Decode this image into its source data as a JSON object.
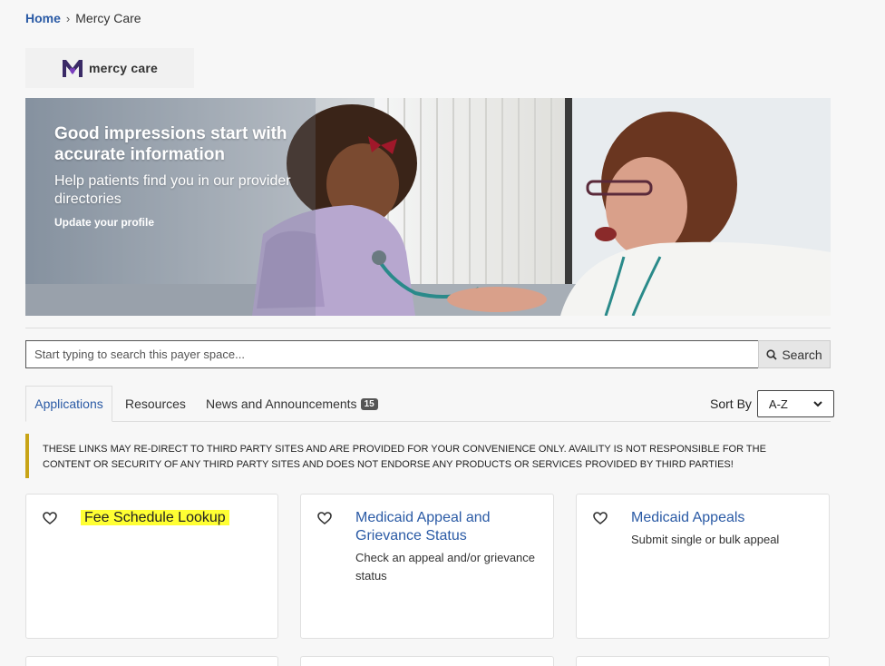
{
  "breadcrumb": {
    "home": "Home",
    "separator": "›",
    "current": "Mercy Care"
  },
  "logo": {
    "text": "mercy care",
    "accent": "#3a2a66",
    "heart": "#7b3fbf"
  },
  "hero": {
    "title": "Good impressions start with accurate information",
    "subtitle": "Help patients find you in our provider directories",
    "link": "Update your profile"
  },
  "search": {
    "placeholder": "Start typing to search this payer space...",
    "button": "Search",
    "icon": "search-icon"
  },
  "tabs": [
    {
      "label": "Applications",
      "active": true
    },
    {
      "label": "Resources",
      "active": false
    },
    {
      "label": "News and Announcements",
      "badge": "15",
      "active": false
    }
  ],
  "sort": {
    "label": "Sort By",
    "value": "A-Z"
  },
  "notice": "THESE LINKS MAY RE-DIRECT TO THIRD PARTY SITES AND ARE PROVIDED FOR YOUR CONVENIENCE ONLY. AVAILITY IS NOT RESPONSIBLE FOR THE CONTENT OR SECURITY OF ANY THIRD PARTY SITES AND DOES NOT ENDORSE ANY PRODUCTS OR SERVICES PROVIDED BY THIRD PARTIES!",
  "cards": [
    {
      "title": "Fee Schedule Lookup",
      "description": "",
      "highlighted": true
    },
    {
      "title": "Medicaid Appeal and Grievance Status",
      "description": "Check an appeal and/or grievance status"
    },
    {
      "title": "Medicaid Appeals",
      "description": "Submit single or bulk appeal"
    }
  ],
  "colors": {
    "link": "#2a5aa5",
    "notice_border": "#c8a416",
    "highlight": "#ffff33"
  }
}
